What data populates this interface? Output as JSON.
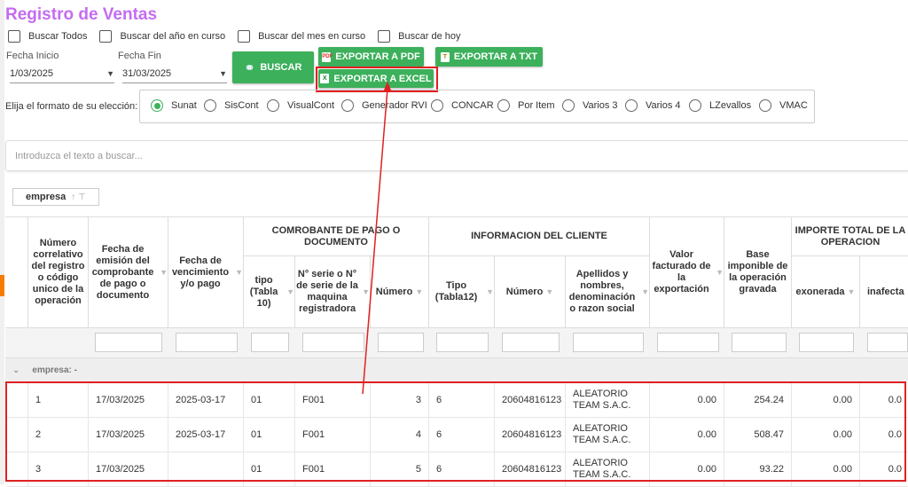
{
  "title": "Registro de Ventas",
  "filters": {
    "checks": [
      "Buscar Todos",
      "Buscar del año en curso",
      "Buscar del mes en curso",
      "Buscar de hoy"
    ],
    "fecha_inicio_label": "Fecha Inicio",
    "fecha_inicio_value": "1/03/2025",
    "fecha_fin_label": "Fecha Fin",
    "fecha_fin_value": "31/03/2025"
  },
  "buttons": {
    "buscar": "BUSCAR",
    "pdf": "EXPORTAR A PDF",
    "txt": "EXPORTAR A TXT",
    "excel": "EXPORTAR A EXCEL"
  },
  "format": {
    "label": "Elija el formato de su elección:",
    "options": [
      "Sunat",
      "SisCont",
      "VisualCont",
      "Generador RVI",
      "CONCAR",
      "Por Item",
      "Varios 3",
      "Varios 4",
      "LZevallos",
      "VMAC"
    ],
    "selected": "Sunat"
  },
  "search": {
    "placeholder": "Introduzca el texto a buscar..."
  },
  "group_chip": "empresa",
  "columns": {
    "num": "Número correlativo del registro o código unico de la operación",
    "fecha_emision": "Fecha de emisión del comprobante de pago o documento",
    "fecha_venc": "Fecha de vencimiento y/o pago",
    "comprobante_group": "COMROBANTE DE PAGO O DOCUMENTO",
    "tipo": "tipo (Tabla 10)",
    "serie": "N° serie o N° de serie de la maquina registradora",
    "numero": "Número",
    "cliente_group": "INFORMACION DEL CLIENTE",
    "tipo_doc": "Tipo (Tabla12)",
    "num_doc": "Número",
    "apellidos": "Apellidos y nombres, denominación o razon social",
    "valor_export": "Valor facturado de la exportación",
    "base_imponible": "Base imponible de la operación gravada",
    "importe_group": "IMPORTE TOTAL DE LA OPERACION",
    "exonerada": "exonerada",
    "inafecta": "inafecta"
  },
  "group_row": {
    "label": "empresa: -"
  },
  "rows": [
    {
      "num": "1",
      "fecha": "17/03/2025",
      "venc": "2025-03-17",
      "tipo": "01",
      "serie": "F001",
      "numero": "3",
      "tipo_doc": "6",
      "num_doc": "20604816123",
      "nombre": "ALEATORIO TEAM S.A.C.",
      "export": "0.00",
      "base": "254.24",
      "exon": "0.00",
      "inaf": "0.0"
    },
    {
      "num": "2",
      "fecha": "17/03/2025",
      "venc": "2025-03-17",
      "tipo": "01",
      "serie": "F001",
      "numero": "4",
      "tipo_doc": "6",
      "num_doc": "20604816123",
      "nombre": "ALEATORIO TEAM S.A.C.",
      "export": "0.00",
      "base": "508.47",
      "exon": "0.00",
      "inaf": "0.0"
    },
    {
      "num": "3",
      "fecha": "17/03/2025",
      "venc": "",
      "tipo": "01",
      "serie": "F001",
      "numero": "5",
      "tipo_doc": "6",
      "num_doc": "20604816123",
      "nombre": "ALEATORIO TEAM S.A.C.",
      "export": "0.00",
      "base": "93.22",
      "exon": "0.00",
      "inaf": "0.0"
    }
  ],
  "colors": {
    "accent": "#3cb05b",
    "title": "#c46cf2",
    "highlight": "#e02020"
  }
}
